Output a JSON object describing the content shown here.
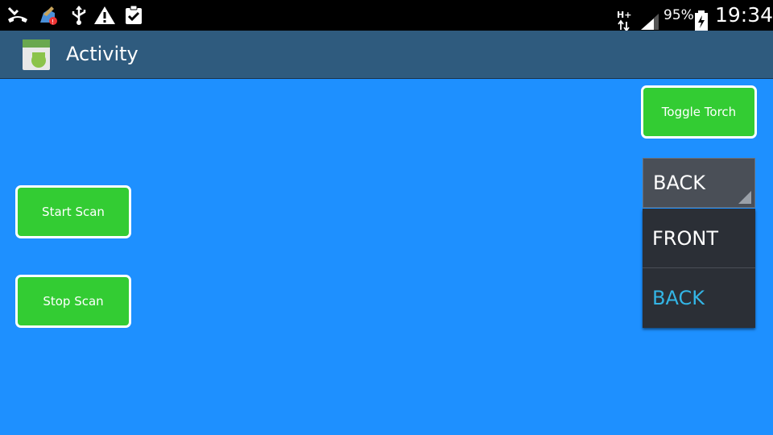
{
  "statusbar": {
    "battery_percent": "95%",
    "time": "19:34",
    "network": "H+",
    "icons": [
      "missed-call-icon",
      "app-notification-icon",
      "usb-icon",
      "warning-icon",
      "clipboard-check-icon",
      "network-hplus-icon",
      "signal-icon",
      "battery-charging-icon"
    ]
  },
  "actionbar": {
    "title": "Activity",
    "app_icon": "android-app-icon"
  },
  "buttons": {
    "start_scan": "Start Scan",
    "stop_scan": "Stop Scan",
    "toggle_torch": "Toggle Torch"
  },
  "camera_spinner": {
    "selected": "BACK",
    "options": [
      "FRONT",
      "BACK"
    ]
  },
  "colors": {
    "background": "#1e90ff",
    "button": "#33cc33",
    "actionbar": "#2f5b7e",
    "selected_option": "#33b5e5"
  }
}
